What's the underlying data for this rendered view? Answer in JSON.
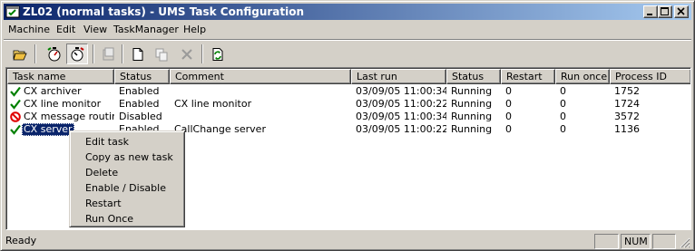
{
  "window": {
    "title": "ZL02 (normal tasks) - UMS Task Configuration",
    "controls": {
      "minimize": "_",
      "maximize": "□",
      "close": "✕"
    }
  },
  "menu": [
    {
      "label": "Machine"
    },
    {
      "label": "Edit"
    },
    {
      "label": "View"
    },
    {
      "label": "TaskManager"
    },
    {
      "label": "Help"
    }
  ],
  "toolbar": {
    "buttons": [
      "open-folder",
      "start-task",
      "stop-task",
      "properties",
      "new",
      "copy",
      "delete",
      "refresh"
    ],
    "pressed": "stop-task"
  },
  "table": {
    "columns": [
      "Task name",
      "Status",
      "Comment",
      "Last run",
      "Status",
      "Restart",
      "Run once",
      "Process ID"
    ],
    "rows": [
      {
        "icon": "check",
        "name": "CX archiver",
        "status": "Enabled",
        "comment": "",
        "last_run": "03/09/05 11:00:34",
        "run_status": "Running",
        "restart": "0",
        "run_once": "0",
        "pid": "1752"
      },
      {
        "icon": "check",
        "name": "CX line monitor",
        "status": "Enabled",
        "comment": "CX line monitor",
        "last_run": "03/09/05 11:00:22",
        "run_status": "Running",
        "restart": "0",
        "run_once": "0",
        "pid": "1724"
      },
      {
        "icon": "disabled",
        "name": "CX message routing",
        "status": "Disabled",
        "comment": "",
        "last_run": "03/09/05 11:00:34",
        "run_status": "Running",
        "restart": "0",
        "run_once": "0",
        "pid": "3572"
      },
      {
        "icon": "check",
        "name": "CX server",
        "status": "Enabled",
        "comment": "CallChange server",
        "last_run": "03/09/05 11:00:22",
        "run_status": "Running",
        "restart": "0",
        "run_once": "0",
        "pid": "1136",
        "selected": true
      }
    ]
  },
  "context_menu": [
    {
      "label": "Edit task"
    },
    {
      "label": "Copy as new task"
    },
    {
      "label": "Delete"
    },
    {
      "label": "Enable / Disable"
    },
    {
      "label": "Restart"
    },
    {
      "label": "Run Once"
    }
  ],
  "statusbar": {
    "text": "Ready",
    "num": "NUM"
  },
  "colors": {
    "title_start": "#0a246a",
    "title_end": "#a6caf0",
    "selection": "#0a246a",
    "check": "#008000",
    "disabled": "#e00000"
  }
}
